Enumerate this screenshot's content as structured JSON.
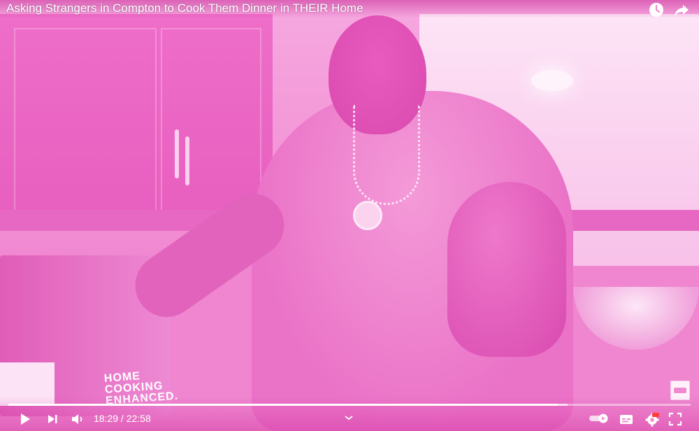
{
  "video": {
    "title": "Asking Strangers in Compton to Cook Them Dinner in THEIR Home",
    "scene_text": "HOME COOKING ENHANCED."
  },
  "top_bar": {
    "icons": [
      "clock-icon",
      "share-icon"
    ]
  },
  "player": {
    "current_time": "18:29",
    "separator": " / ",
    "duration": "22:58",
    "progress_fraction": 0.805,
    "buffered_fraction": 0.82,
    "controls": [
      "play-icon",
      "next-icon",
      "volume-icon",
      "chevron-up-icon",
      "autoplay-toggle",
      "subtitles-icon",
      "settings-icon",
      "fullscreen-icon"
    ]
  },
  "colors": {
    "tint": "#f28ad0",
    "control": "#ffffff",
    "hd_badge": "#ff3b3b"
  }
}
